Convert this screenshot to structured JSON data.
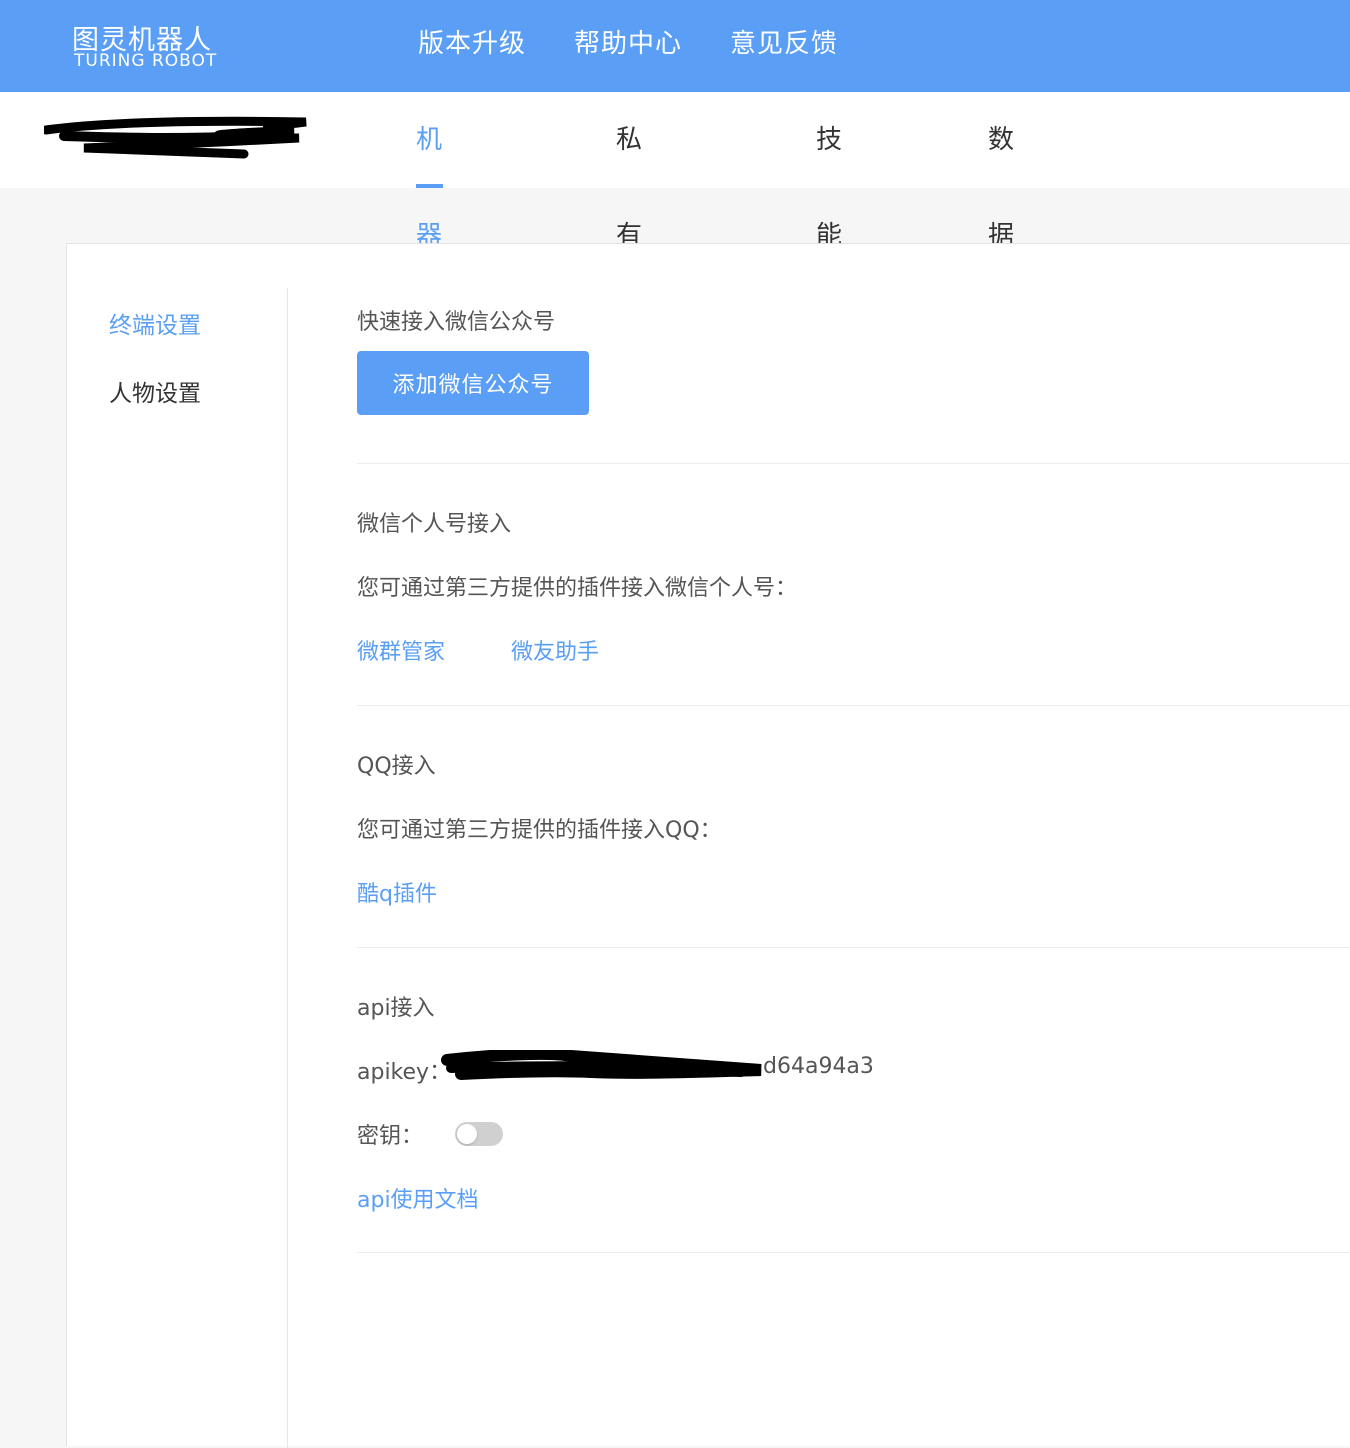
{
  "header": {
    "logo_cn": "图灵机器人",
    "logo_en": "TURING ROBOT",
    "nav": [
      "版本升级",
      "帮助中心",
      "意见反馈"
    ]
  },
  "tabs": [
    {
      "label": "机器人设置",
      "active": true
    },
    {
      "label": "私有语料库",
      "active": false
    },
    {
      "label": "技能拓展",
      "active": false
    },
    {
      "label": "数据中心",
      "active": false
    }
  ],
  "sidebar": {
    "items": [
      {
        "label": "终端设置",
        "active": true
      },
      {
        "label": "人物设置",
        "active": false
      }
    ]
  },
  "sections": {
    "wechat_official": {
      "title": "快速接入微信公众号",
      "button": "添加微信公众号"
    },
    "wechat_personal": {
      "title": "微信个人号接入",
      "desc": "您可通过第三方提供的插件接入微信个人号：",
      "links": [
        "微群管家",
        "微友助手"
      ]
    },
    "qq": {
      "title": "QQ接入",
      "desc": "您可通过第三方提供的插件接入QQ：",
      "links": [
        "酷q插件"
      ]
    },
    "api": {
      "title": "api接入",
      "apikey_label": "apikey：",
      "apikey_visible_suffix": "d64a94a3",
      "secret_label": "密钥：",
      "secret_enabled": false,
      "doc_link": "api使用文档"
    }
  },
  "colors": {
    "accent": "#5a9ff5",
    "background": "#f6f6f6"
  }
}
